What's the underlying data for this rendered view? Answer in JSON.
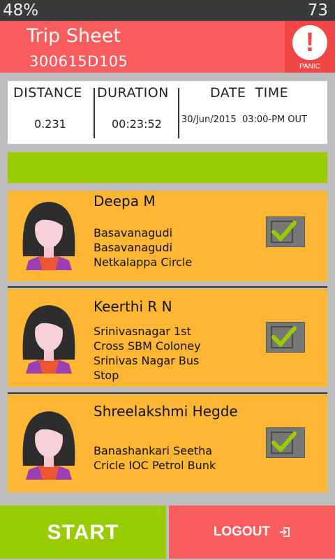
{
  "status_bar": {
    "battery_left": "48%",
    "battery_right": "73"
  },
  "header": {
    "title": "Trip Sheet",
    "trip_id": "300615D105",
    "panic_label": "PANIC",
    "panic_glyph": "!"
  },
  "stats": {
    "distance_label": "DISTANCE",
    "distance_value": "0.231",
    "duration_label": "DURATION",
    "duration_value": "00:23:52",
    "datetime_label": "DATE  TIME",
    "datetime_value": "30/Jun/2015  03:00-PM OUT"
  },
  "passengers": [
    {
      "name": "Deepa M",
      "address": [
        "Basavanagudi",
        "Basavanagudi",
        "Netkalappa Circle"
      ],
      "checked": true
    },
    {
      "name": "Keerthi R N",
      "address": [
        "Srinivasnagar 1st",
        "Cross SBM Coloney",
        "Srinivas Nagar Bus",
        "Stop"
      ],
      "checked": true
    },
    {
      "name": "Shreelakshmi Hegde",
      "address": [
        "Banashankari Seetha",
        "Cricle IOC Petrol Bunk"
      ],
      "checked": true
    }
  ],
  "buttons": {
    "start": "START",
    "logout": "LOGOUT"
  },
  "colors": {
    "header": "#f95c5c",
    "green": "#99cc00",
    "card": "#ffb733",
    "check": "#99cc00"
  },
  "icons": {
    "panic": "exclamation-icon",
    "logout": "logout-icon",
    "check": "checkmark-icon",
    "avatar": "female-avatar-icon"
  }
}
